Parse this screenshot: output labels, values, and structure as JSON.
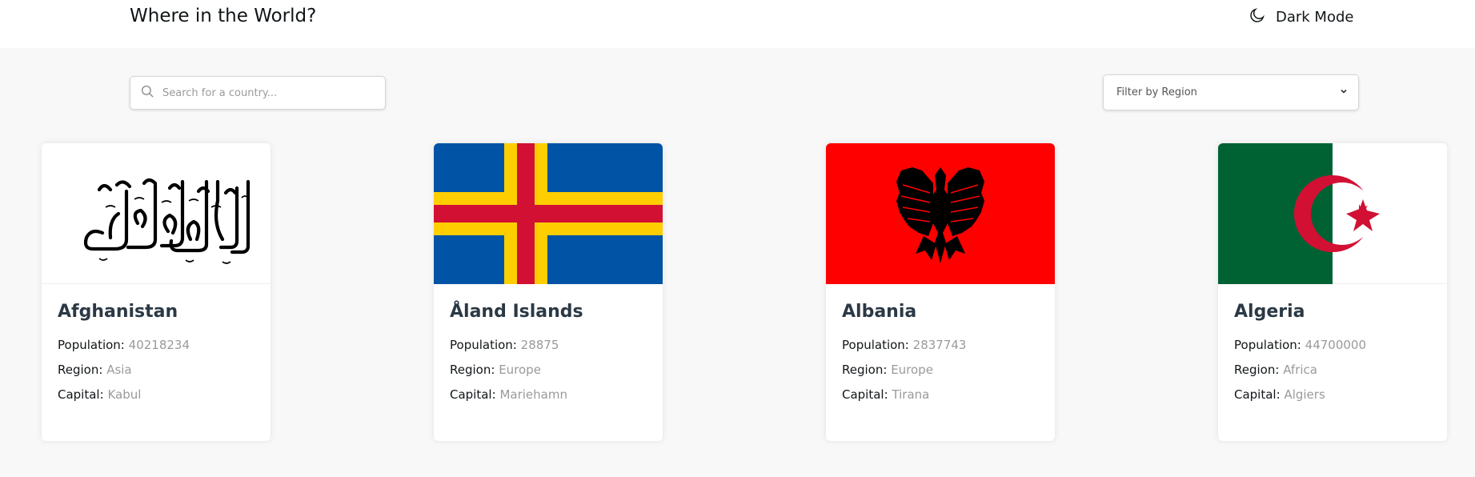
{
  "header": {
    "title": "Where in the World?",
    "mode_label": "Dark Mode",
    "mode_icon": "moon-icon"
  },
  "search": {
    "placeholder": "Search for a country...",
    "icon": "search-icon"
  },
  "filter": {
    "label": "Filter by Region",
    "icon": "chevron-down-icon"
  },
  "labels": {
    "population": "Population:",
    "region": "Region:",
    "capital": "Capital:"
  },
  "countries": [
    {
      "name": "Afghanistan",
      "population": "40218234",
      "region": "Asia",
      "capital": "Kabul"
    },
    {
      "name": "Åland Islands",
      "population": "28875",
      "region": "Europe",
      "capital": "Mariehamn"
    },
    {
      "name": "Albania",
      "population": "2837743",
      "region": "Europe",
      "capital": "Tirana"
    },
    {
      "name": "Algeria",
      "population": "44700000",
      "region": "Africa",
      "capital": "Algiers"
    }
  ],
  "colors": {
    "background": "#f8f8f8",
    "card": "#ffffff",
    "country_name": "#2b3945",
    "value_text": "#9a9a9a",
    "aland_blue": "#0053a5",
    "aland_yellow": "#ffce00",
    "aland_red": "#d21034",
    "albania_red": "#ff0000",
    "algeria_green": "#006233",
    "algeria_red": "#d21034"
  }
}
